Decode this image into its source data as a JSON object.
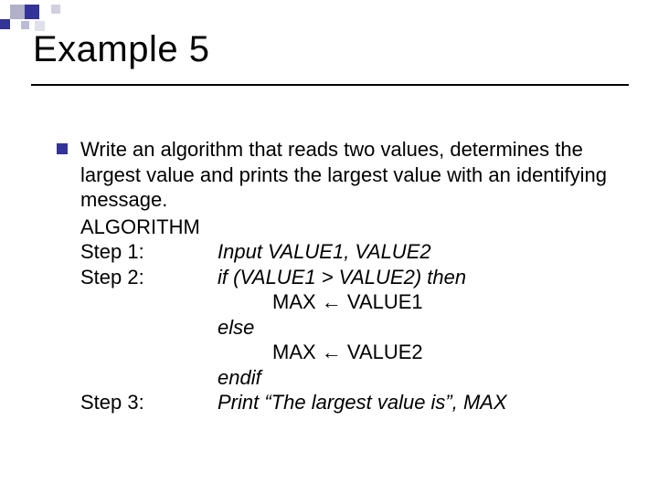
{
  "title": "Example 5",
  "bullet_text": "Write an algorithm that reads two values, determines the largest value and prints the largest value with an identifying message.",
  "algorithm_label": "ALGORITHM",
  "steps": {
    "s1": {
      "label": "Step 1:",
      "line1": "Input VALUE1, VALUE2"
    },
    "s2": {
      "label": "Step 2:",
      "line1": "if (VALUE1 > VALUE2) then",
      "line2": "MAX ← VALUE1",
      "line3": "else",
      "line4": "MAX ← VALUE2",
      "line5": "endif"
    },
    "s3": {
      "label": "Step 3:",
      "line1": "Print “The largest value is”, MAX"
    }
  }
}
